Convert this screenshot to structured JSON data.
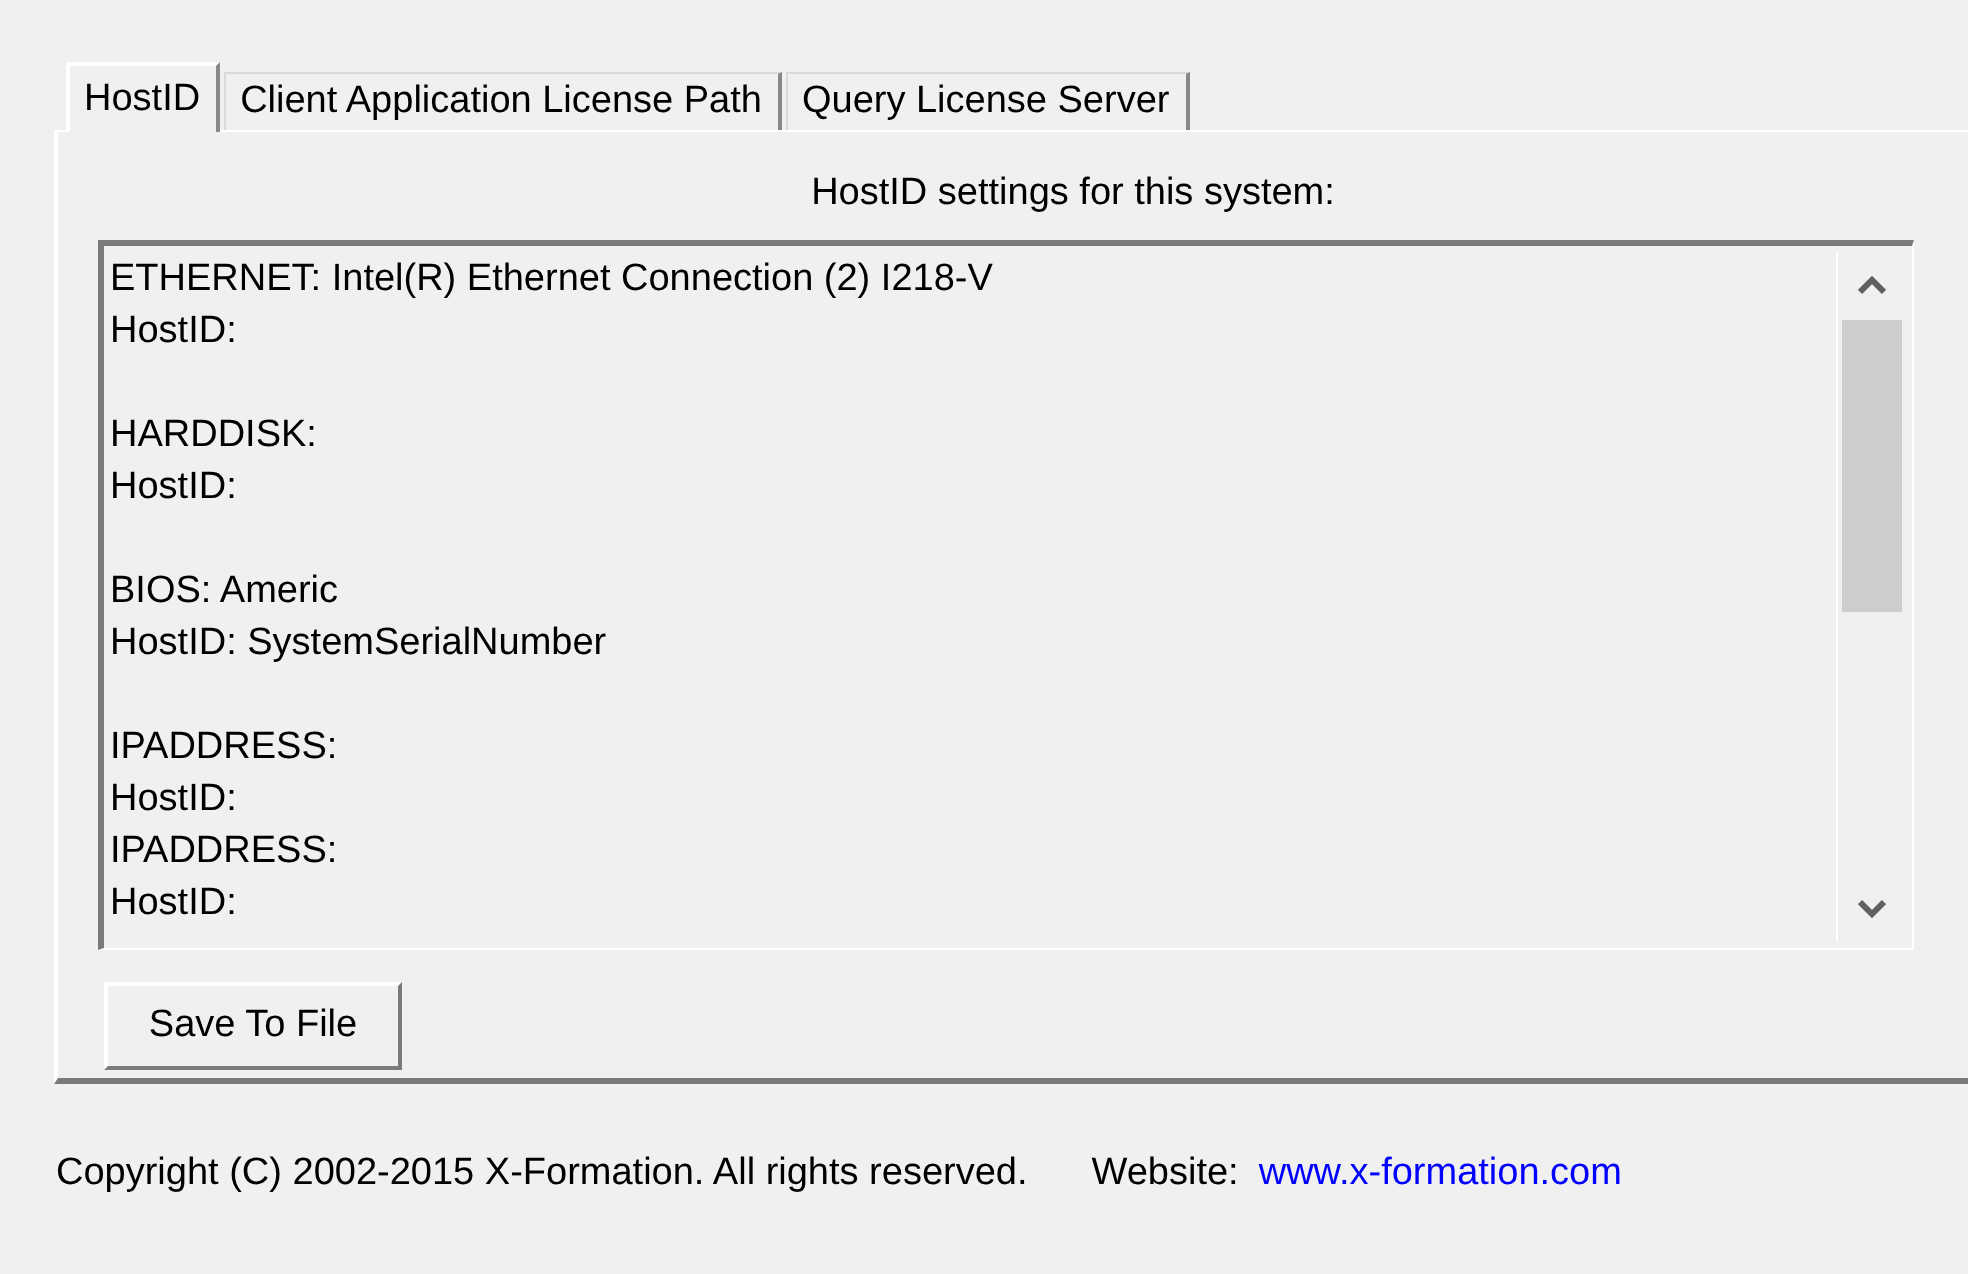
{
  "tabs": [
    {
      "label": "HostID",
      "selected": true
    },
    {
      "label": "Client Application License Path",
      "selected": false
    },
    {
      "label": "Query License Server",
      "selected": false
    }
  ],
  "heading": "HostID settings for this system:",
  "host_info": {
    "blocks": [
      [
        "ETHERNET: Intel(R) Ethernet Connection (2) I218-V",
        "HostID:"
      ],
      [
        "HARDDISK:",
        "HostID:"
      ],
      [
        "BIOS: Americ",
        "HostID: SystemSerialNumber"
      ],
      [
        "IPADDRESS:",
        "HostID:",
        "IPADDRESS:",
        "HostID:"
      ]
    ]
  },
  "save_button": "Save To File",
  "footer": {
    "copyright": "Copyright (C) 2002-2015 X-Formation. All rights reserved.",
    "website_label": "Website:",
    "website_link": "www.x-formation.com"
  }
}
